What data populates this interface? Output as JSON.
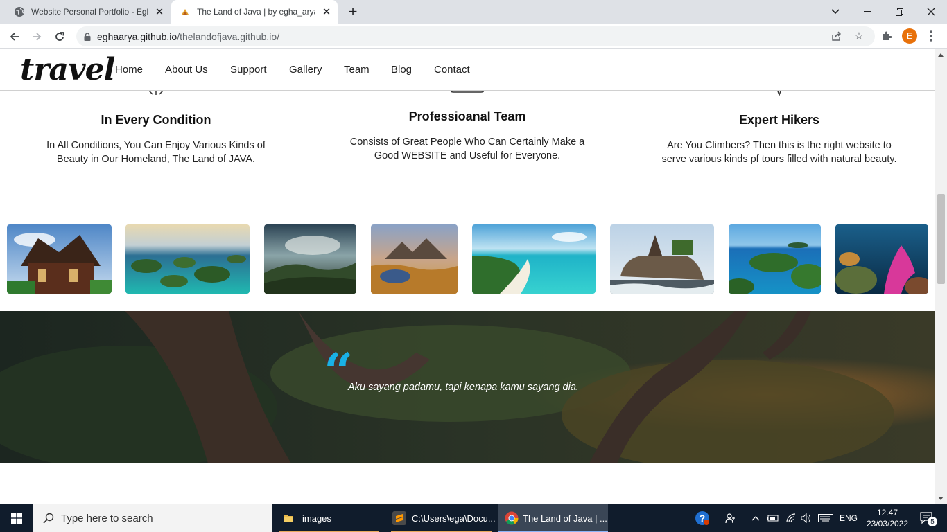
{
  "browser": {
    "tabs": [
      {
        "title": "Website Personal Portfolio - Egha",
        "active": false
      },
      {
        "title": "The Land of Java | by egha_arya a",
        "active": true
      }
    ],
    "url_host": "eghaarya.github.io",
    "url_path": "/thelandofjava.github.io/",
    "profile_initial": "E"
  },
  "site": {
    "logo": "travel",
    "nav": [
      "Home",
      "About Us",
      "Support",
      "Gallery",
      "Team",
      "Blog",
      "Contact"
    ],
    "features": [
      {
        "title": "In Every Condition",
        "text": "In All Conditions, You Can Enjoy Various Kinds of Beauty in Our Homeland, The Land of JAVA."
      },
      {
        "title": "Professioanal Team",
        "text": "Consists of Great People Who Can Certainly Make a Good WEBSITE and Useful for Everyone."
      },
      {
        "title": "Expert Hikers",
        "text": "Are You Climbers? Then this is the right website to serve various kinds pf tours filled with natural beauty."
      }
    ],
    "quote": "Aku sayang padamu, tapi kenapa kamu sayang dia."
  },
  "taskbar": {
    "search_placeholder": "Type here to search",
    "apps": [
      "images",
      "C:\\Users\\ega\\Docu...",
      "The Land of Java | ..."
    ],
    "language": "ENG",
    "time": "12.47",
    "date": "23/03/2022",
    "notifications": "5"
  },
  "colors": {
    "accent_quote": "#19b1e6",
    "taskbar": "#101c2c",
    "tab_strip": "#dee1e6"
  }
}
